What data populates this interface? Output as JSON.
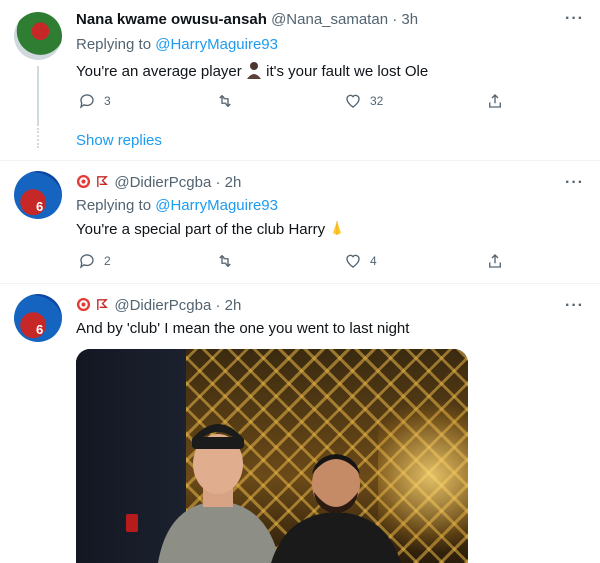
{
  "tweets": [
    {
      "name": "Nana kwame owusu-ansah",
      "handle": "@Nana_samatan",
      "time": "3h",
      "replying_label": "Replying to",
      "replying_handle": "@HarryMaguire93",
      "text_before": "You're an average player",
      "text_after": "it's your fault we lost Ole",
      "replies": "3",
      "retweets": "",
      "likes": "32",
      "show_replies": "Show replies"
    },
    {
      "name": "",
      "handle": "@DidierPcgba",
      "time": "2h",
      "replying_label": "Replying to",
      "replying_handle": "@HarryMaguire93",
      "text": "You're a special part of the club Harry",
      "replies": "2",
      "retweets": "",
      "likes": "4"
    },
    {
      "name": "",
      "handle": "@DidierPcgba",
      "time": "2h",
      "text": "And by 'club' I mean the one you went to last night"
    }
  ],
  "avatar_number": "6",
  "more_label": "···",
  "separator": "·",
  "colors": {
    "accent": "#1d9bf0",
    "muted": "#536471",
    "text": "#0f1419",
    "divider": "#eff3f4"
  },
  "icons": [
    "reply-icon",
    "retweet-icon",
    "like-icon",
    "share-icon",
    "more-icon",
    "target-emoji-icon",
    "pin-emoji-icon",
    "person-emoji-icon",
    "pray-emoji-icon"
  ]
}
